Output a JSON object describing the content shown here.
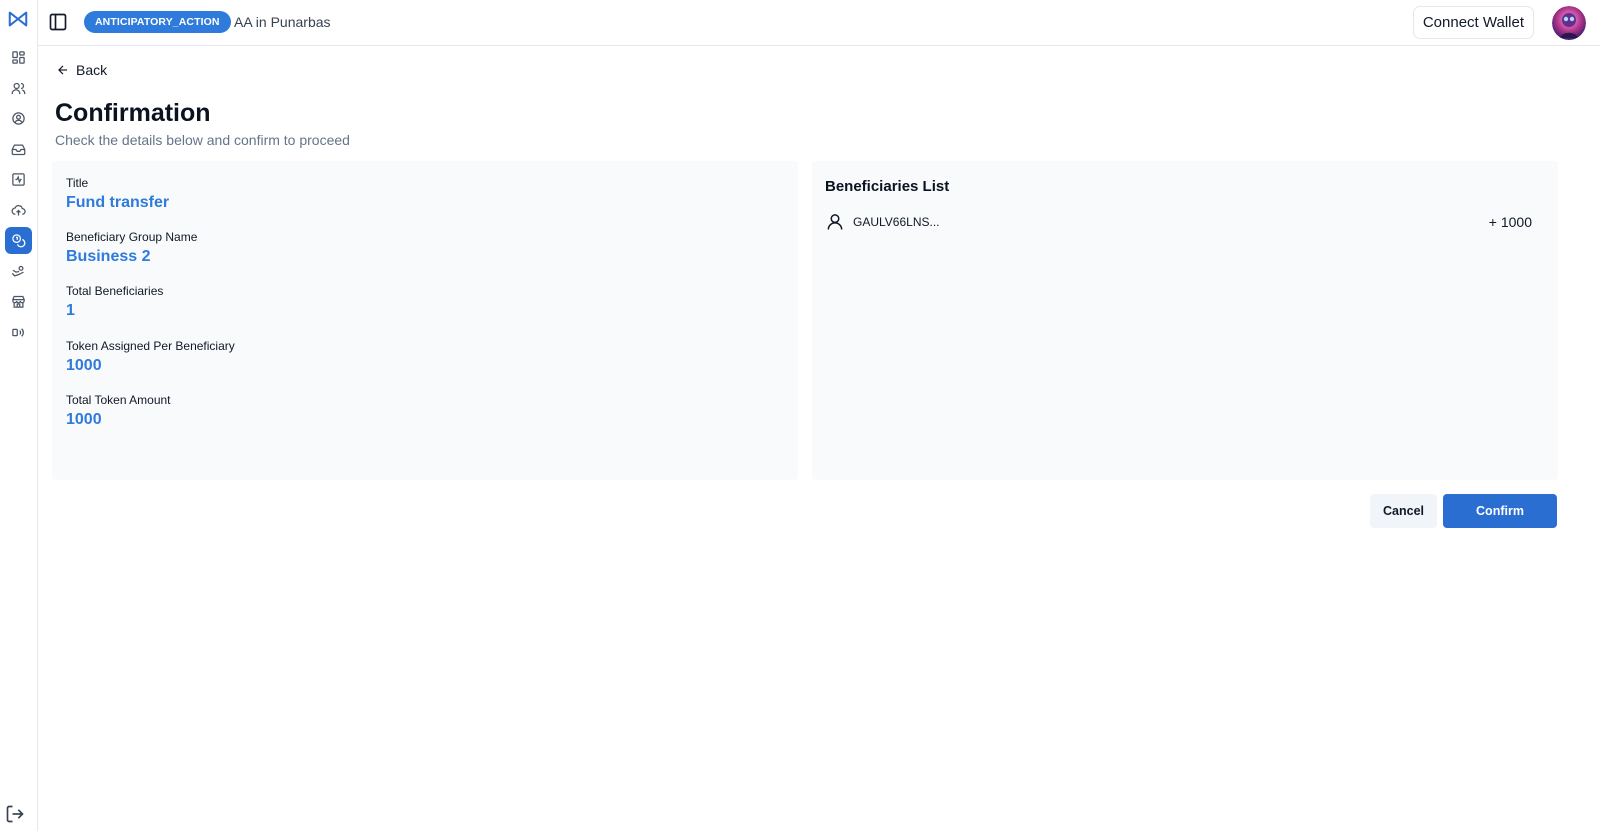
{
  "header": {
    "badge": "ANTICIPATORY_ACTION",
    "project_name": "AA in Punarbas",
    "connect_wallet_label": "Connect Wallet"
  },
  "sidebar": {
    "items": [
      {
        "icon": "dashboard-icon"
      },
      {
        "icon": "users-icon"
      },
      {
        "icon": "user-circle-icon"
      },
      {
        "icon": "inbox-icon"
      },
      {
        "icon": "activity-icon"
      },
      {
        "icon": "cloud-upload-icon"
      },
      {
        "icon": "coins-icon",
        "active": true
      },
      {
        "icon": "hand-coins-icon"
      },
      {
        "icon": "store-icon"
      },
      {
        "icon": "broadcast-icon"
      }
    ],
    "logout_icon": "logout-icon"
  },
  "page": {
    "back_label": "Back",
    "title": "Confirmation",
    "subtitle": "Check the details below and confirm to proceed"
  },
  "details": {
    "fields": [
      {
        "label": "Title",
        "value": "Fund transfer"
      },
      {
        "label": "Beneficiary Group Name",
        "value": "Business 2"
      },
      {
        "label": "Total Beneficiaries",
        "value": "1"
      },
      {
        "label": "Token Assigned Per Beneficiary",
        "value": "1000"
      },
      {
        "label": "Total Token Amount",
        "value": "1000"
      }
    ]
  },
  "beneficiaries": {
    "title": "Beneficiaries List",
    "items": [
      {
        "id": "GAULV66LNS...",
        "amount": "+ 1000"
      }
    ]
  },
  "actions": {
    "cancel_label": "Cancel",
    "confirm_label": "Confirm"
  },
  "colors": {
    "accent": "#2f7bdc",
    "button_primary": "#2a6ed2",
    "card_bg": "#f8fafc"
  }
}
